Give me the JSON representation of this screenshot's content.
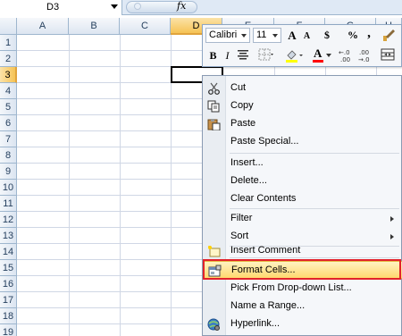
{
  "formula_bar": {
    "name_box": "D3",
    "fx_label": "fx"
  },
  "columns": [
    "A",
    "B",
    "C",
    "D",
    "E",
    "F",
    "G",
    "H"
  ],
  "selected_column": "D",
  "rows": [
    "1",
    "2",
    "3",
    "4",
    "5",
    "6",
    "7",
    "8",
    "9",
    "10",
    "11",
    "12",
    "13",
    "14",
    "15",
    "16",
    "17",
    "18",
    "19"
  ],
  "selected_row": "3",
  "mini_toolbar": {
    "font_name": "Calibri",
    "font_size": "11",
    "grow_font": "A",
    "shrink_font": "A",
    "currency": "$",
    "percent": "%",
    "comma": ",",
    "bold": "B",
    "italic": "I",
    "font_color_letter": "A",
    "increase_decimal": "+.0 .00",
    "decrease_decimal": ".00 +.0"
  },
  "context_menu": {
    "items": [
      {
        "label": "Cut",
        "icon": "scissors-icon"
      },
      {
        "label": "Copy",
        "icon": "copy-icon"
      },
      {
        "label": "Paste",
        "icon": "paste-icon"
      },
      {
        "label": "Paste Special...",
        "icon": ""
      },
      {
        "label": "Insert...",
        "icon": ""
      },
      {
        "label": "Delete...",
        "icon": ""
      },
      {
        "label": "Clear Contents",
        "icon": ""
      },
      {
        "label": "Filter",
        "icon": "",
        "submenu": true
      },
      {
        "label": "Sort",
        "icon": "",
        "submenu": true
      },
      {
        "label": "Insert Comment",
        "icon": "insert-comment-icon"
      },
      {
        "label": "Format Cells...",
        "icon": "format-cells-icon",
        "highlighted": true
      },
      {
        "label": "Pick From Drop-down List...",
        "icon": ""
      },
      {
        "label": "Name a Range...",
        "icon": ""
      },
      {
        "label": "Hyperlink...",
        "icon": "hyperlink-icon"
      }
    ]
  },
  "colors": {
    "header_bg": "#dde6f1",
    "selected_header": "#f6c355",
    "highlight": "#ffd86e",
    "callout_border": "#e2222a"
  }
}
